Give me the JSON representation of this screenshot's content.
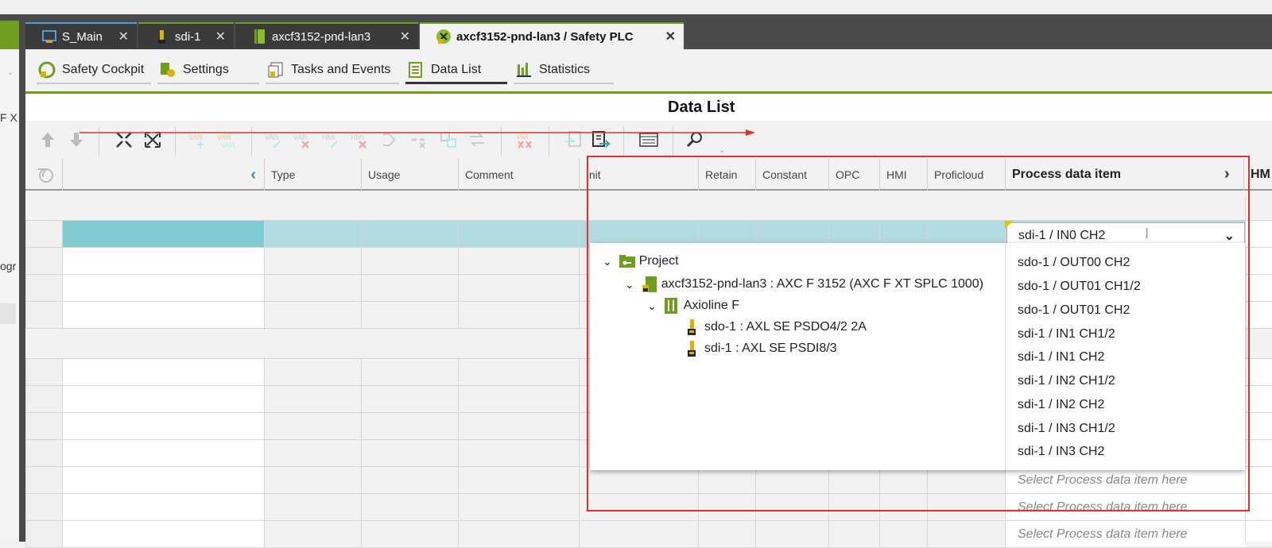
{
  "left_panel": {
    "fragment_1": "F X",
    "fragment_2": "ogr"
  },
  "tabs": [
    {
      "label": "S_Main"
    },
    {
      "label": "sdi-1"
    },
    {
      "label": "axcf3152-pnd-lan3"
    },
    {
      "label": "axcf3152-pnd-lan3 / Safety PLC"
    }
  ],
  "subtabs": [
    {
      "label": "Safety Cockpit"
    },
    {
      "label": "Settings"
    },
    {
      "label": "Tasks and Events"
    },
    {
      "label": "Data List"
    },
    {
      "label": "Statistics"
    }
  ],
  "page_title": "Data List",
  "columns": [
    "Type",
    "Usage",
    "Comment",
    "Init",
    "Retain",
    "Constant",
    "OPC",
    "HMI",
    "Proficloud",
    "Process data item",
    "HM"
  ],
  "combo_value": "sdi-1 / IN0 CH2",
  "tree": [
    {
      "label": "Project"
    },
    {
      "label": "axcf3152-pnd-lan3 : AXC F 3152 (AXC F XT SPLC 1000)"
    },
    {
      "label": "Axioline F"
    },
    {
      "label": "sdo-1 : AXL SE PSDO4/2 2A"
    },
    {
      "label": "sdi-1 : AXL SE PSDI8/3"
    }
  ],
  "process_items": [
    "sdo-1 / OUT00 CH2",
    "sdo-1 / OUT01 CH1/2",
    "sdo-1 / OUT01 CH2",
    "sdi-1 / IN1 CH1/2",
    "sdi-1 / IN1 CH2",
    "sdi-1 / IN2 CH1/2",
    "sdi-1 / IN2 CH2",
    "sdi-1 / IN3 CH1/2",
    "sdi-1 / IN3 CH2"
  ],
  "placeholder": "Select Process data item here",
  "colors": {
    "accent": "#6f9e1f",
    "selected_row": "#b2dbe0",
    "selected_cell": "#7fcbd2",
    "annotation": "#e23030"
  }
}
